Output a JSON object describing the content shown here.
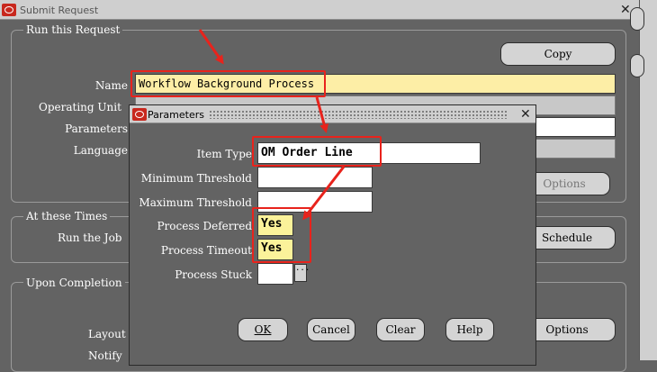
{
  "main_window": {
    "title": "Submit Request",
    "run_section": "Run this Request",
    "copy_button": "Copy",
    "name_label": "Name",
    "name_value": "Workflow Background Process",
    "operating_unit_label": "Operating Unit",
    "parameters_label": "Parameters",
    "language_label": "Language",
    "options_button_1": "Options",
    "times_section": "At these Times",
    "run_job_label": "Run the Job",
    "schedule_button": "Schedule",
    "completion_section": "Upon Completion",
    "layout_label": "Layout",
    "notify_label": "Notify",
    "options_button_2": "Options"
  },
  "params_dialog": {
    "title": "Parameters",
    "fields": {
      "item_type": {
        "label": "Item Type",
        "value": "OM Order Line"
      },
      "min_threshold": {
        "label": "Minimum Threshold",
        "value": ""
      },
      "max_threshold": {
        "label": "Maximum Threshold",
        "value": ""
      },
      "process_deferred": {
        "label": "Process Deferred",
        "value": "Yes"
      },
      "process_timeout": {
        "label": "Process Timeout",
        "value": "Yes"
      },
      "process_stuck": {
        "label": "Process Stuck",
        "value": ""
      }
    },
    "ellipsis": "...",
    "buttons": {
      "ok": "OK",
      "cancel": "Cancel",
      "clear": "Clear",
      "help": "Help"
    }
  },
  "colors": {
    "annotation": "#e8231c",
    "background": "#636363",
    "name_field": "#fdeea6",
    "yes_field": "#fbf29a"
  }
}
